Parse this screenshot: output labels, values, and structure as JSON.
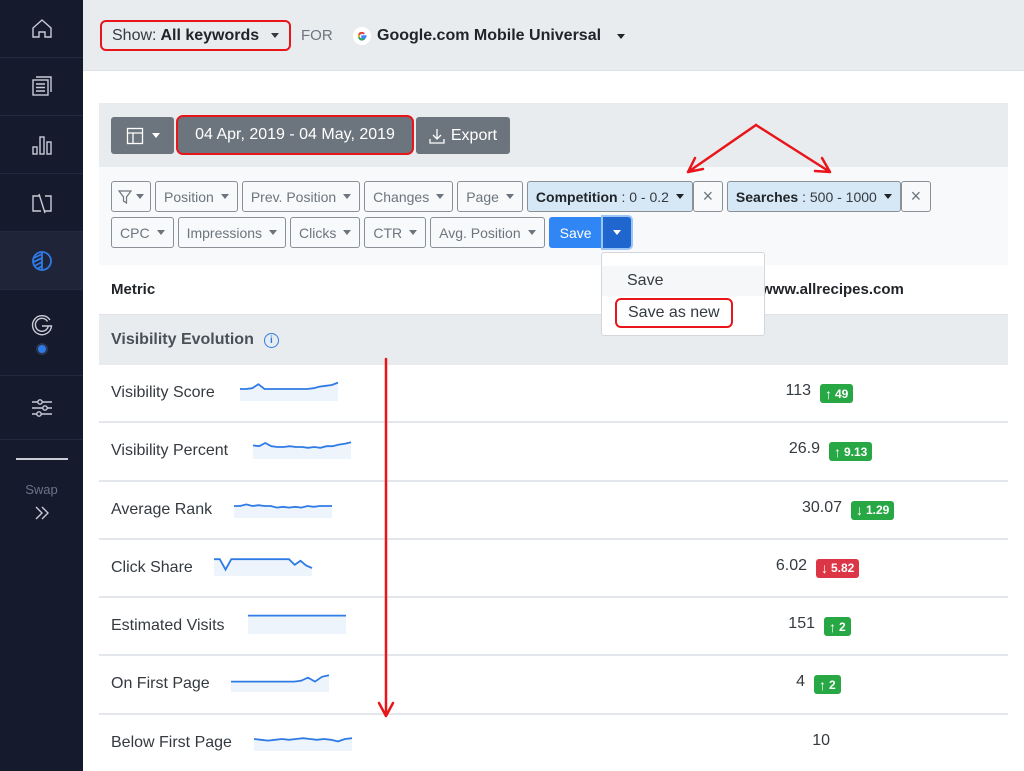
{
  "sidebar": {
    "items": [
      {
        "icon": "home-icon"
      },
      {
        "icon": "document-icon"
      },
      {
        "icon": "bar-chart-icon"
      },
      {
        "icon": "compare-icon"
      },
      {
        "icon": "visibility-icon",
        "active": true
      },
      {
        "icon": "google-icon",
        "has_dot": true
      },
      {
        "icon": "sliders-icon"
      }
    ],
    "swap_label": "Swap"
  },
  "topbar": {
    "show_prefix": "Show:",
    "show_value": "All keywords",
    "for_label": "FOR",
    "engine": "Google.com Mobile Universal"
  },
  "toolbar": {
    "date_range": "04 Apr, 2019 - 04 May, 2019",
    "export_label": "Export"
  },
  "filters": {
    "row1": [
      "Position",
      "Prev. Position",
      "Changes",
      "Page"
    ],
    "active": [
      {
        "name": "Competition",
        "value": ": 0 - 0.2"
      },
      {
        "name": "Searches",
        "value": ": 500 - 1000"
      }
    ],
    "row2": [
      "CPC",
      "Impressions",
      "Clicks",
      "CTR",
      "Avg. Position"
    ],
    "save_label": "Save"
  },
  "save_menu": {
    "items": [
      "Save",
      "Save as new"
    ]
  },
  "table": {
    "metric_header": "Metric",
    "domain_header": "www.allrecipes.com",
    "section_title": "Visibility Evolution",
    "rows": [
      {
        "label": "Visibility Score",
        "value": "113",
        "change": "49",
        "direction": "up",
        "status": "green"
      },
      {
        "label": "Visibility Percent",
        "value": "26.9",
        "change": "9.13",
        "direction": "up",
        "status": "green"
      },
      {
        "label": "Average Rank",
        "value": "30.07",
        "change": "1.29",
        "direction": "down",
        "status": "green"
      },
      {
        "label": "Click Share",
        "value": "6.02",
        "change": "5.82",
        "direction": "down",
        "status": "red"
      },
      {
        "label": "Estimated Visits",
        "value": "151",
        "change": "2",
        "direction": "up",
        "status": "green"
      },
      {
        "label": "On First Page",
        "value": "4",
        "change": "2",
        "direction": "up",
        "status": "green"
      },
      {
        "label": "Below First Page",
        "value": "10",
        "change": null,
        "direction": null,
        "status": null
      }
    ]
  },
  "colors": {
    "sidebar_bg": "#151a2d",
    "accent_blue": "#2f7be6",
    "badge_green": "#28a745",
    "badge_red": "#dc3545",
    "annotation_red": "#e8161b"
  }
}
